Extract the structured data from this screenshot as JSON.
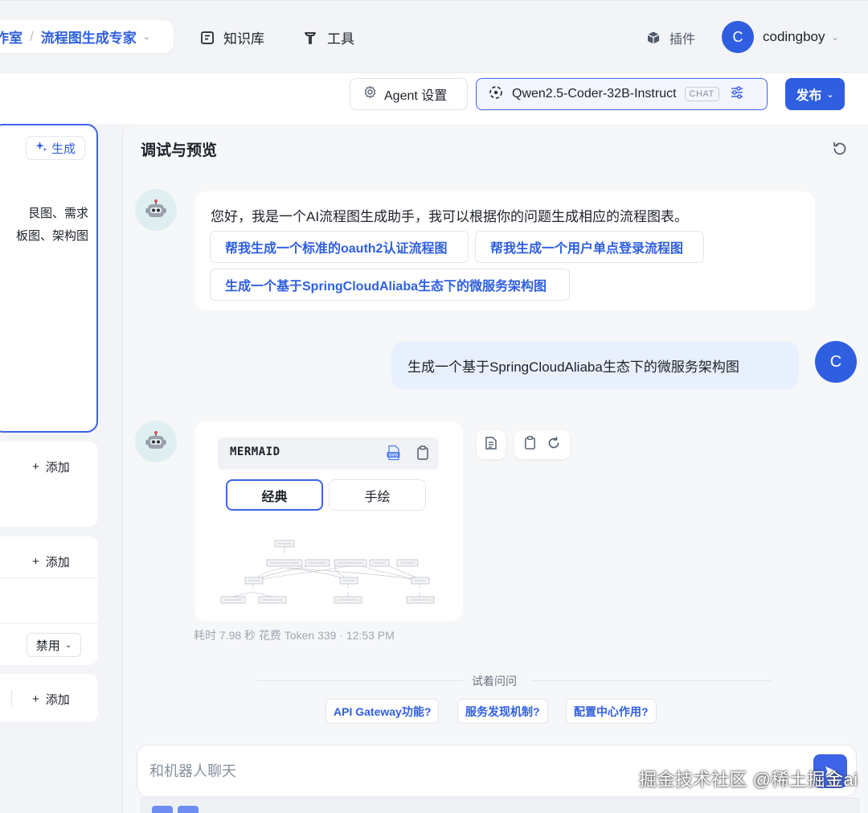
{
  "header": {
    "breadcrumb": {
      "workspace": "作室",
      "separator": "/",
      "current": "流程图生成专家"
    },
    "nav": [
      {
        "label": "知识库",
        "icon": "book-icon"
      },
      {
        "label": "工具",
        "icon": "hammer-icon"
      }
    ],
    "plugins_label": "插件",
    "user": {
      "initial": "C",
      "name": "codingboy"
    }
  },
  "toolbar": {
    "agent_settings_label": "Agent 设置",
    "model_name": "Qwen2.5-Coder-32B-Instruct",
    "model_tag": "CHAT",
    "publish_label": "发布"
  },
  "left_panel": {
    "generate_label": "生成",
    "prompt_lines": "艮图、需求\n板图、架构图",
    "add_label": "添加",
    "select_value": "禁用"
  },
  "preview": {
    "title": "调试与预览",
    "welcome_message": "您好，我是一个AI流程图生成助手，我可以根据你的问题生成相应的流程图表。",
    "suggestions": [
      "帮我生成一个标准的oauth2认证流程图",
      "帮我生成一个用户单点登录流程图",
      "生成一个基于SpringCloudAliaba生态下的微服务架构图"
    ],
    "user_message": "生成一个基于SpringCloudAliaba生态下的微服务架构图",
    "user_initial": "C",
    "mermaid": {
      "label": "MERMAID",
      "modes": [
        "经典",
        "手绘"
      ],
      "active_mode": "经典",
      "svg_badge": "SVG"
    },
    "meta": "耗时 7.98 秒   花费 Token 339  ·  12:53 PM",
    "try_label": "试着问问",
    "try_questions": [
      "API Gateway功能?",
      "服务发现机制?",
      "配置中心作用?"
    ],
    "input_placeholder": "和机器人聊天",
    "watermark": "掘金技术社区 @稀土掘金ai"
  },
  "colors": {
    "accent": "#2f5fe0",
    "accent_border": "#3d63e6",
    "user_bubble": "#e8f0fd",
    "bot_avatar_bg": "#dfeff1"
  }
}
